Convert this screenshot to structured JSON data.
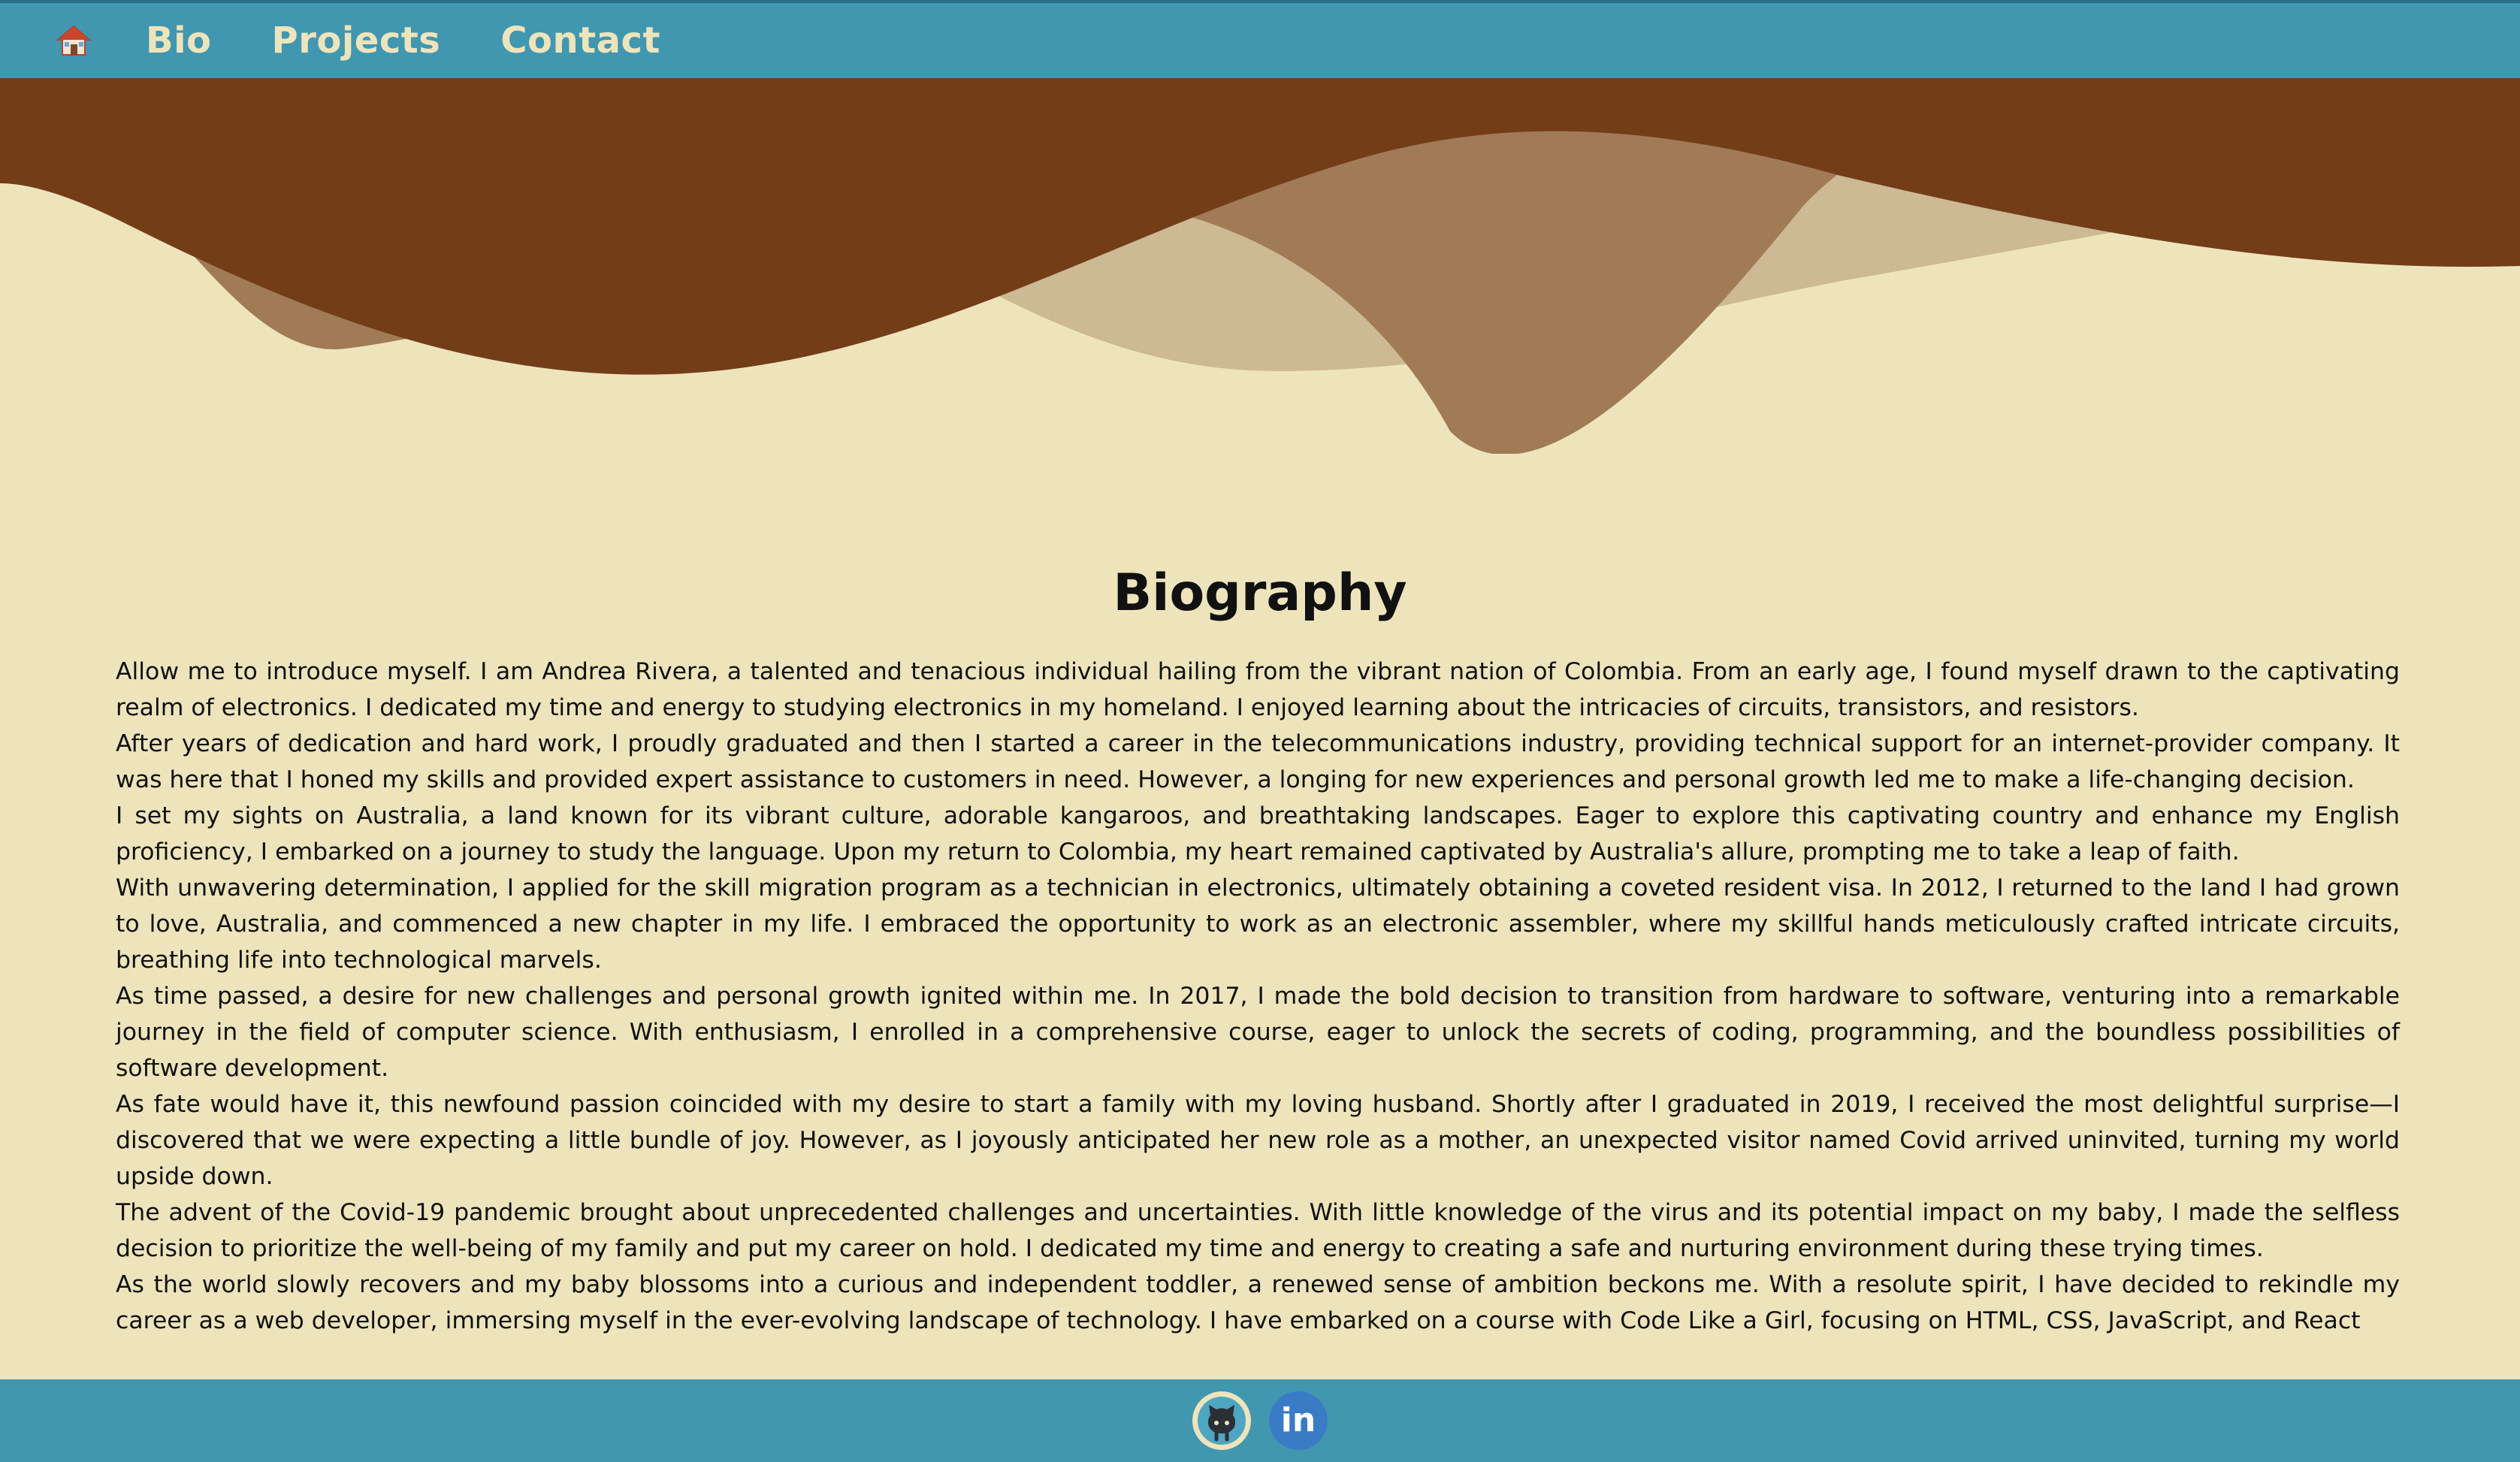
{
  "nav": {
    "home_icon": "house-icon",
    "links": [
      "Bio",
      "Projects",
      "Contact"
    ]
  },
  "colors": {
    "nav_bg": "#4197B0",
    "page_bg": "#EEE4BC",
    "nav_text": "#EEE4BC",
    "wave_dark": "#733D18",
    "wave_mid": "#A07B55",
    "wave_light": "#CDB993"
  },
  "main": {
    "title": "Biography",
    "paragraphs": [
      "Allow me to introduce myself. I am Andrea Rivera, a talented and tenacious individual hailing from the vibrant nation of Colombia. From an early age, I found myself drawn to the captivating realm of electronics. I dedicated my time and energy to studying electronics in my homeland. I enjoyed learning about the intricacies of circuits, transistors, and resistors.",
      "After years of dedication and hard work, I proudly graduated and then I started a career in the telecommunications industry, providing technical support for an internet-provider company. It was here that I honed my skills and provided expert assistance to customers in need. However, a longing for new experiences and personal growth led me to make a life-changing decision.",
      "I set my sights on Australia, a land known for its vibrant culture, adorable kangaroos, and breathtaking landscapes. Eager to explore this captivating country and enhance my English proficiency, I embarked on a journey to study the language. Upon my return to Colombia, my heart remained captivated by Australia's allure, prompting me to take a leap of faith.",
      "With unwavering determination, I applied for the skill migration program as a technician in electronics, ultimately obtaining a coveted resident visa. In 2012, I returned to the land I had grown to love, Australia, and commenced a new chapter in my life. I embraced the opportunity to work as an electronic assembler, where my skillful hands meticulously crafted intricate circuits, breathing life into technological marvels.",
      "As time passed, a desire for new challenges and personal growth ignited within me. In 2017, I made the bold decision to transition from hardware to software, venturing into a remarkable journey in the field of computer science. With enthusiasm, I enrolled in a comprehensive course, eager to unlock the secrets of coding, programming, and the boundless possibilities of software development.",
      "As fate would have it, this newfound passion coincided with my desire to start a family with my loving husband. Shortly after I graduated in 2019, I received the most delightful surprise—I discovered that we were expecting a little bundle of joy. However, as I joyously anticipated her new role as a mother, an unexpected visitor named Covid arrived uninvited, turning my world upside down.",
      "The advent of the Covid-19 pandemic brought about unprecedented challenges and uncertainties. With little knowledge of the virus and its potential impact on my baby, I made the selfless decision to prioritize the well-being of my family and put my career on hold. I dedicated my time and energy to creating a safe and nurturing environment during these trying times.",
      "As the world slowly recovers and my baby blossoms into a curious and independent toddler, a renewed sense of ambition beckons me. With a resolute spirit, I have decided to rekindle my career as a web developer, immersing myself in the ever-evolving landscape of technology. I have embarked on a course with Code Like a Girl, focusing on HTML, CSS, JavaScript, and React"
    ]
  },
  "footer": {
    "icons": [
      "github-icon",
      "linkedin-icon"
    ],
    "linkedin_text": "in"
  }
}
